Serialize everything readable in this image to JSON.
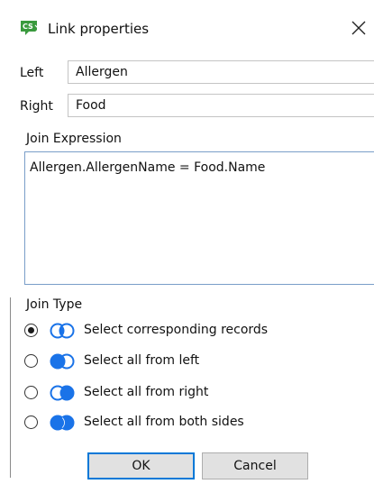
{
  "window": {
    "title": "Link properties",
    "icon_name": "cs-app-icon",
    "close_glyph": "✕"
  },
  "fields": {
    "left_label": "Left",
    "left_value": "Allergen",
    "right_label": "Right",
    "right_value": "Food"
  },
  "join_expression": {
    "label": "Join Expression",
    "value": "Allergen.AllergenName = Food.Name"
  },
  "join_type": {
    "label": "Join Type",
    "options": [
      {
        "label": "Select corresponding records",
        "icon": "venn-inner-join-icon",
        "checked": true
      },
      {
        "label": "Select all from left",
        "icon": "venn-left-join-icon",
        "checked": false
      },
      {
        "label": "Select all from right",
        "icon": "venn-right-join-icon",
        "checked": false
      },
      {
        "label": "Select all from both sides",
        "icon": "venn-full-join-icon",
        "checked": false
      }
    ]
  },
  "buttons": {
    "ok_label": "OK",
    "cancel_label": "Cancel"
  },
  "colors": {
    "accent": "#0078d7",
    "venn_blue": "#1a73e8",
    "app_icon_green": "#3a9a3e"
  }
}
